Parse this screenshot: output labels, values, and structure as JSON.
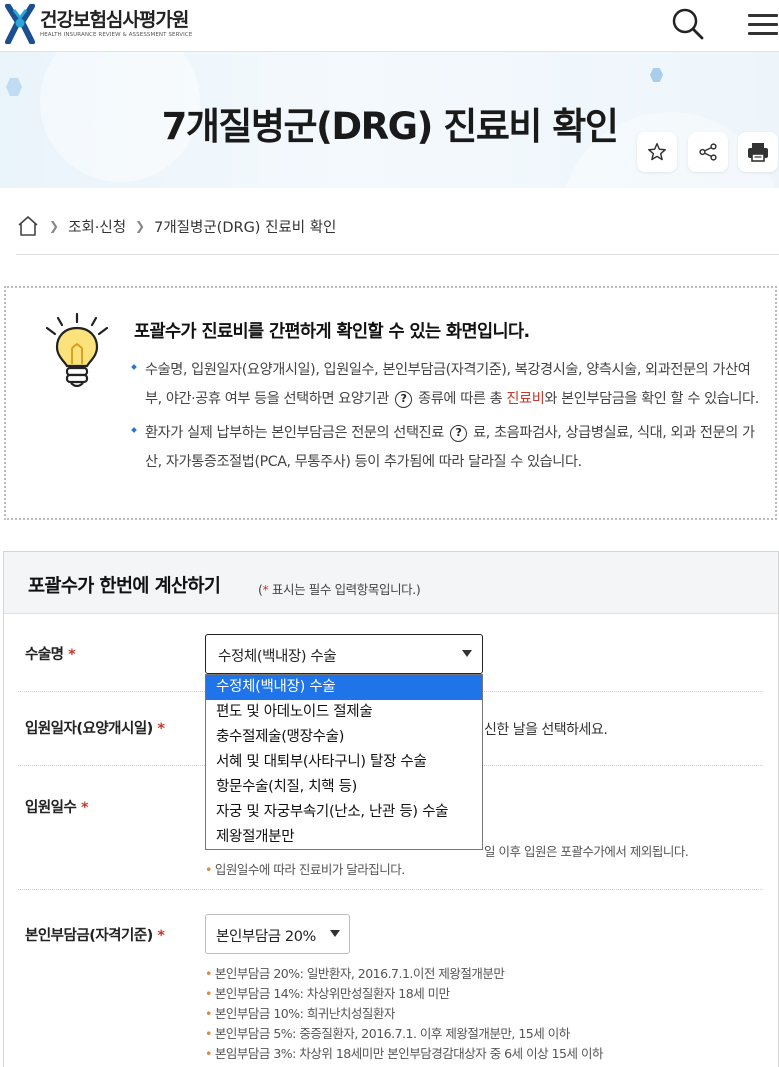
{
  "header": {
    "logo_kr": "건강보험심사평가원",
    "logo_en": "HEALTH INSURANCE REVIEW & ASSESSMENT SERVICE",
    "icons": [
      "search-icon",
      "menu-icon"
    ]
  },
  "banner": {
    "title": "7개질병군(DRG) 진료비 확인",
    "actions": [
      "star-icon",
      "share-icon",
      "print-icon"
    ]
  },
  "breadcrumb": {
    "home_icon": "home-icon",
    "items": [
      "조회·신청",
      "7개질병군(DRG) 진료비 확인"
    ]
  },
  "info": {
    "headline": "포괄수가 진료비를 간편하게 확인할 수 있는 화면입니다.",
    "b1_part1": "수술명, 입원일자(요양개시일), 입원일수, 본인부담금(자격기준), 복강경시술, 양측시술, 외과전문의 가산여부, 야간·공휴 여부 등을 선택하면  요양기관",
    "b1_part2": "종류에 따른 총",
    "b1_highlight": "진료비",
    "b1_part3": "와 본인부담금을 확인 할 수 있습니다.",
    "b2_part1": "환자가 실제 납부하는 본인부담금은 전문의 선택진료",
    "b2_part2": "료, 초음파검사, 상급병실료, 식대, 외과 전문의 가산, 자가통증조절법(PCA, 무통주사) 등이 추가됨에 따라 달라질 수 있습니다.",
    "help_mark": "?"
  },
  "calc": {
    "title": "포괄수가 한번에 계산하기",
    "note_open": "(",
    "note_star": "*",
    "note_text": " 표시는 필수 입력항목입니다.)",
    "required_mark": "*",
    "surgery": {
      "label": "수술명",
      "selected": "수정체(백내장) 수술",
      "options": [
        "수정체(백내장) 수술",
        "편도 및 아데노이드 절제술",
        "충수절제술(맹장수술)",
        "서혜 및 대퇴부(사타구니) 탈장 수술",
        "항문수술(치질, 치핵 등)",
        "자궁 및 자궁부속기(난소, 난관 등) 수술",
        "제왕절개분만"
      ]
    },
    "admission_date": {
      "label": "입원일자(요양개시일)",
      "hint_tail": "신한 날을 선택하세요."
    },
    "admission_days": {
      "label": "입원일수",
      "hint1_tail": "일 이후 입원은 포괄수가에서 제외됩니다.",
      "hint2": "입원일수에 따라 진료비가 달라집니다."
    },
    "copay": {
      "label": "본인부담금(자격기준)",
      "selected": "본인부담금 20%",
      "notes": [
        "본인부담금 20%: 일반환자, 2016.7.1.이전 제왕절개분만",
        "본인부담금 14%: 차상위만성질환자 18세 미만",
        "본인부담금 10%: 희귀난치성질환자",
        "본인부담금 5%: 중증질환자, 2016.7.1. 이후 제왕절개분만, 15세 이하",
        "본임부담금 3%: 차상위 18세미만 본인부담경감대상자 중 6세 이상 15세 이하"
      ]
    },
    "bullet": "•"
  }
}
